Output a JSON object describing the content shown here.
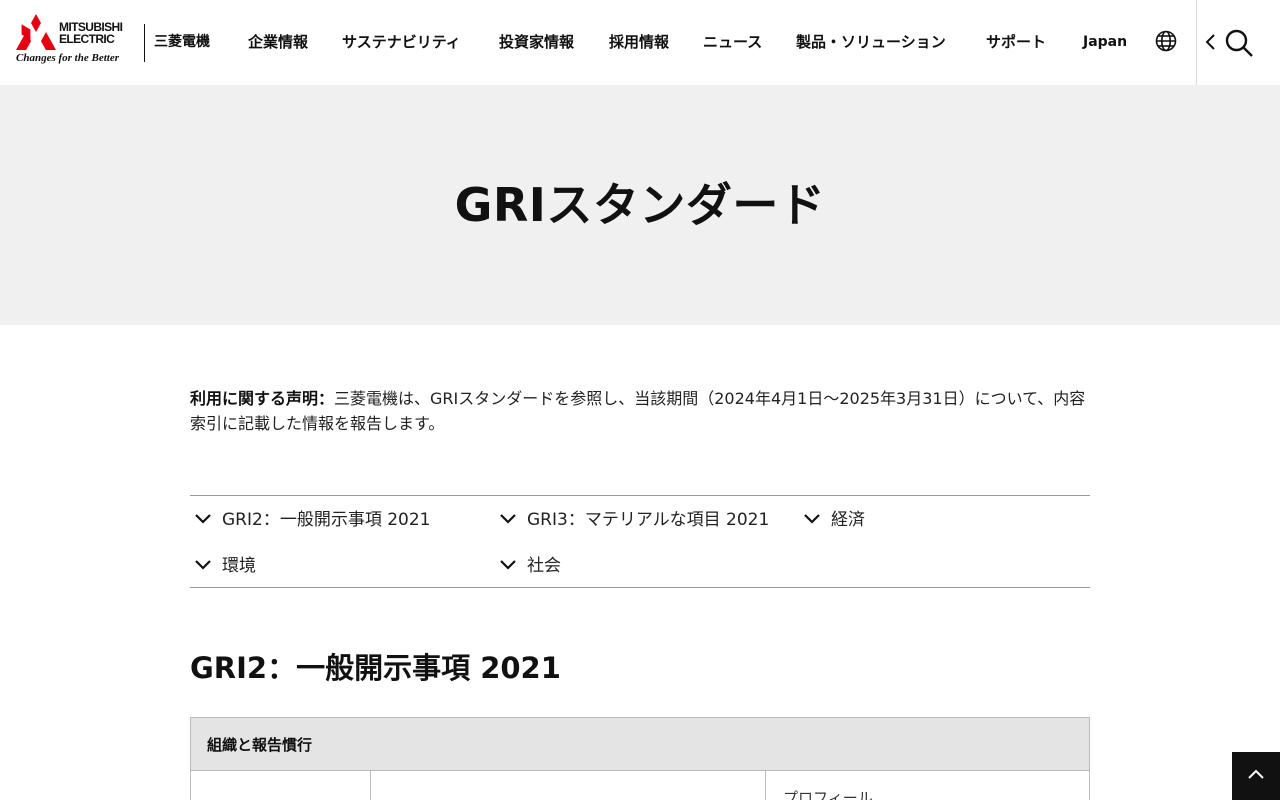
{
  "header": {
    "logo_word_line1": "MITSUBISHI",
    "logo_word_line2": "ELECTRIC",
    "logo_tagline": "Changes for the Better",
    "company_name_jp": "三菱電機",
    "nav": [
      {
        "label": "企業情報"
      },
      {
        "label": "サステナビリティ"
      },
      {
        "label": "投資家情報"
      },
      {
        "label": "採用情報"
      },
      {
        "label": "ニュース"
      },
      {
        "label": "製品・ソリューション"
      },
      {
        "label": "サポート"
      },
      {
        "label": "Japan"
      }
    ],
    "icons": [
      "globe-icon",
      "chevron-left-icon",
      "search-icon"
    ]
  },
  "hero": {
    "title": "GRIスタンダード"
  },
  "statement": {
    "lead": "利用に関する声明：",
    "text": "三菱電機は、GRIスタンダードを参照し、当該期間（2024年4月1日～2025年3月31日）について、内容索引に記載した情報を報告します。"
  },
  "anchors": [
    {
      "label": "GRI2：一般開示事項 2021"
    },
    {
      "label": "GRI3：マテリアルな項目 2021"
    },
    {
      "label": "経済"
    },
    {
      "label": "環境"
    },
    {
      "label": "社会"
    }
  ],
  "section": {
    "title": "GRI2：一般開示事項 2021"
  },
  "table": {
    "header": "組織と報告慣行",
    "first_cell": "プロフィール"
  },
  "colors": {
    "brand_red": "#e60012",
    "hero_bg": "#f0f0f0",
    "table_head_bg": "#e4e4e4"
  }
}
